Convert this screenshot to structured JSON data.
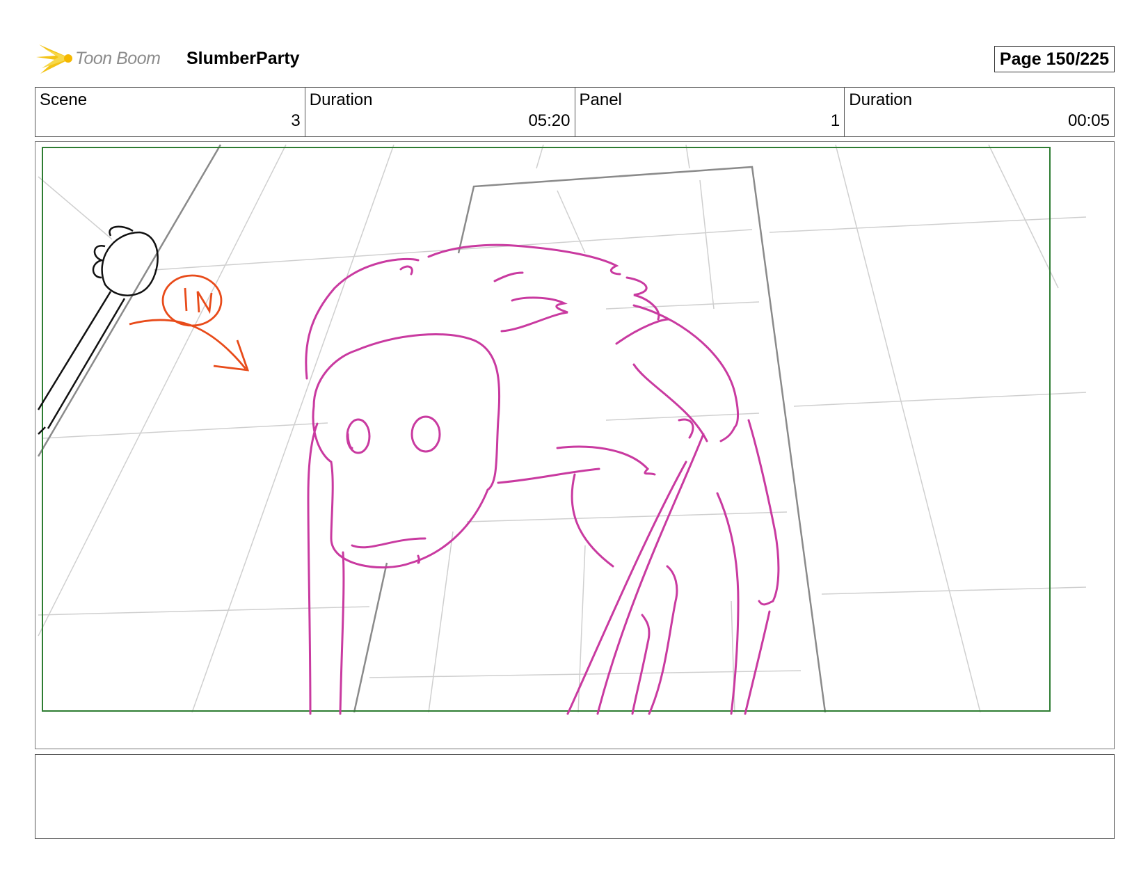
{
  "header": {
    "logo_text": "Toon Boom",
    "project_title": "SlumberParty",
    "page_label": "Page 150/225"
  },
  "info": [
    {
      "label": "Scene",
      "value": "3"
    },
    {
      "label": "Duration",
      "value": "05:20"
    },
    {
      "label": "Panel",
      "value": "1"
    },
    {
      "label": "Duration",
      "value": "00:05"
    }
  ],
  "panel": {
    "annotation_text": "IN"
  },
  "notes": {
    "text": ""
  }
}
